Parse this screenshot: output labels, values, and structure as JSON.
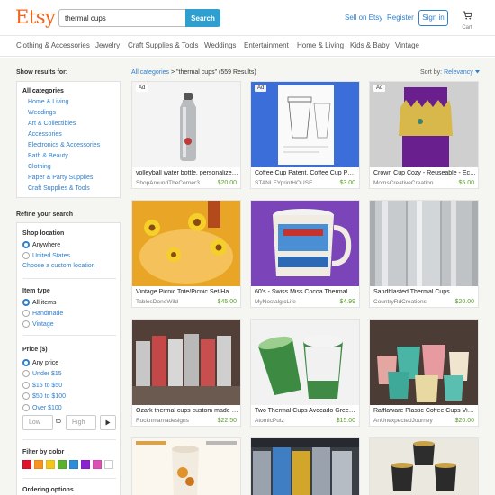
{
  "header": {
    "logo": "Etsy",
    "search_value": "thermal cups",
    "search_button": "Search",
    "sell_link": "Sell on Etsy",
    "register_link": "Register",
    "signin_button": "Sign in",
    "cart_label": "Cart"
  },
  "categories_nav": [
    "Clothing & Accessories",
    "Jewelry",
    "Craft Supplies & Tools",
    "Weddings",
    "Entertainment",
    "Home & Living",
    "Kids & Baby",
    "Vintage"
  ],
  "sidebar": {
    "show_results_heading": "Show results for:",
    "all_categories": "All categories",
    "category_items": [
      "Home & Living",
      "Weddings",
      "Art & Collectibles",
      "Accessories",
      "Electronics & Accessories",
      "Bath & Beauty",
      "Clothing",
      "Paper & Party Supplies",
      "Craft Supplies & Tools"
    ],
    "refine_heading": "Refine your search",
    "shop_location": {
      "label": "Shop location",
      "options": [
        "Anywhere",
        "United States"
      ],
      "selected": 0,
      "custom_link": "Choose a custom location"
    },
    "item_type": {
      "label": "Item type",
      "options": [
        "All items",
        "Handmade",
        "Vintage"
      ],
      "selected": 0
    },
    "price": {
      "label": "Price ($)",
      "options": [
        "Any price",
        "Under $15",
        "$15 to $50",
        "$50 to $100",
        "Over $100"
      ],
      "selected": 0,
      "low_placeholder": "Low",
      "to_label": "to",
      "high_placeholder": "High",
      "go_icon": "play-arrow-icon"
    },
    "color_filter": {
      "label": "Filter by color",
      "colors": [
        "#e0112b",
        "#f7931e",
        "#f5c518",
        "#5ab12e",
        "#2a8fd8",
        "#8b25d2",
        "#e04fb3",
        "#ffffff"
      ]
    },
    "ordering_label": "Ordering options"
  },
  "results": {
    "crumb_link": "All categories",
    "crumb_sep": ">",
    "crumb_query": "\"thermal cups\"",
    "crumb_count": "(559 Results)",
    "sort_label": "Sort by:",
    "sort_value": "Relevancy",
    "items": [
      {
        "ad": "Ad",
        "title": "volleyball water bottle, personalized w...",
        "shop": "ShopAroundTheCorner3",
        "price": "$20.00"
      },
      {
        "ad": "Ad",
        "title": "Coffee Cup Patent, Coffee Cup Poster,...",
        "shop": "STANLEYprintHOUSE",
        "price": "$3.00"
      },
      {
        "ad": "Ad",
        "title": "Crown Cup Cozy - Reuseable - Eco Fri...",
        "shop": "MomsCreativeCreation",
        "price": "$5.00"
      },
      {
        "ad": "",
        "title": "Vintage Picnic Tote/Picnic Set/Hand P...",
        "shop": "TablesDoneWild",
        "price": "$45.00"
      },
      {
        "ad": "",
        "title": "60's - Swiss Miss Cocoa Thermal Cup ...",
        "shop": "MyNostalgicLife",
        "price": "$4.99"
      },
      {
        "ad": "",
        "title": "Sandblasted Thermal Cups",
        "shop": "CountryRdCreations",
        "price": "$20.00"
      },
      {
        "ad": "",
        "title": "Ozark thermal cups custom made glitt...",
        "shop": "Rocknmamadesigns",
        "price": "$22.50"
      },
      {
        "ad": "",
        "title": "Two Thermal Cups Avocado Green Th...",
        "shop": "AtomicPutz",
        "price": "$15.00"
      },
      {
        "ad": "",
        "title": "Rafflaware Plastic Coffee Cups Vintage...",
        "shop": "AnUnexpectedJourney",
        "price": "$20.00"
      },
      {
        "ad": "",
        "title": "",
        "shop": "",
        "price": ""
      },
      {
        "ad": "",
        "title": "",
        "shop": "",
        "price": ""
      },
      {
        "ad": "",
        "title": "",
        "shop": "",
        "price": ""
      }
    ]
  },
  "colors": {
    "brand": "#f1641e",
    "link": "#2f7fcb",
    "search_button": "#2f9fd0",
    "price": "#5c9e2e",
    "background": "#f5f5f1"
  }
}
